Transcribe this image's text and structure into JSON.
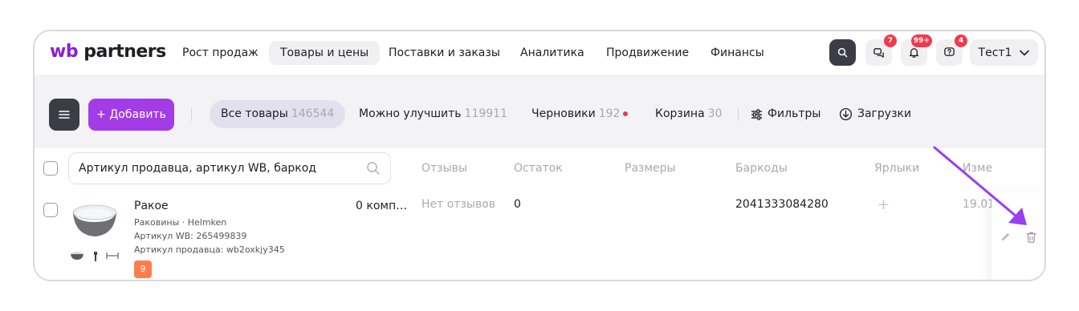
{
  "brand": {
    "wb": "wb",
    "partners": "partners",
    "accent": "#a33be6"
  },
  "nav": {
    "items": [
      {
        "label": "Рост продаж",
        "active": false
      },
      {
        "label": "Товары и цены",
        "active": true
      },
      {
        "label": "Поставки и заказы",
        "active": false
      },
      {
        "label": "Аналитика",
        "active": false
      },
      {
        "label": "Продвижение",
        "active": false
      },
      {
        "label": "Финансы",
        "active": false
      }
    ],
    "search_icon": "search-icon",
    "chat_badge": "7",
    "notifications_badge": "99+",
    "questions_badge": "4",
    "account_name": "Тест1"
  },
  "toolbar": {
    "add_label": "+ Добавить",
    "tabs": [
      {
        "label": "Все товары",
        "count": "146544",
        "active": true
      },
      {
        "label": "Можно улучшить",
        "count": "119911",
        "active": false
      },
      {
        "label": "Черновики",
        "count": "192",
        "active": false,
        "dot": true
      },
      {
        "label": "Корзина",
        "count": "30",
        "active": false
      }
    ],
    "filters_label": "Фильтры",
    "uploads_label": "Загрузки"
  },
  "table": {
    "search_placeholder": "Артикул продавца, артикул WB, баркод",
    "columns": [
      "Отзывы",
      "Остаток",
      "Размеры",
      "Баркоды",
      "Ярлыки",
      "Изме"
    ],
    "row": {
      "name": "Ракое",
      "category": "Раковины · Helmken",
      "article_wb": "Артикул WB: 265499839",
      "article_seller": "Артикул продавца: wb2oxkjy345",
      "rating": "9",
      "kit": "0 комп…",
      "reviews": "Нет отзывов",
      "stock": "0",
      "barcode": "2041333084280",
      "labels_add": "+",
      "date": "19.01"
    }
  },
  "annotation_color": "#9b3df0"
}
